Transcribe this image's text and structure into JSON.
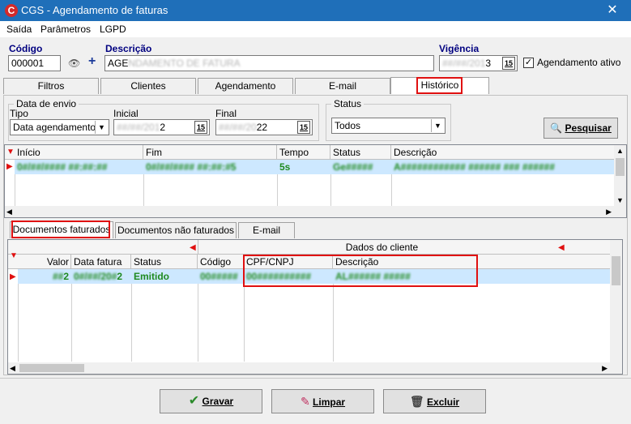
{
  "window": {
    "title": "CGS - Agendamento de faturas",
    "close_glyph": "✕"
  },
  "menu": [
    "Saída",
    "Parâmetros",
    "LGPD"
  ],
  "form": {
    "codigo_label": "Código",
    "codigo_value": "000001",
    "descricao_label": "Descrição",
    "descricao_value": "AGE",
    "descricao_blurred": "NDAMENTO DE FATURA",
    "vigencia_label": "Vigência",
    "vigencia_blurred": "##/##/201",
    "vigencia_end": "3",
    "agendamento_ativo_label": "Agendamento ativo",
    "agendamento_ativo_checked": true
  },
  "tabs": [
    "Filtros",
    "Clientes",
    "Agendamento",
    "E-mail",
    "Histórico"
  ],
  "active_tab": "Histórico",
  "filtros": {
    "data_envio_legend": "Data de envio",
    "tipo_label": "Tipo",
    "tipo_value": "Data agendamento",
    "inicial_label": "Inicial",
    "inicial_blurred": "##/##/201",
    "inicial_end": "2",
    "final_label": "Final",
    "final_blurred": "##/##/20",
    "final_end": "22",
    "status_legend": "Status",
    "status_value": "Todos",
    "pesquisar_label": "Pesquisar",
    "cal_label": "15"
  },
  "historico_grid": {
    "columns": [
      "Início",
      "Fim",
      "Tempo",
      "Status",
      "Descrição"
    ],
    "rows": [
      {
        "inicio": "0#/##/#### ##:##:##",
        "fim": "0#/##/#### ##:##:#5",
        "tempo": "5s",
        "status": "Ge#####",
        "descricao": "A############ ###### ### ######"
      }
    ]
  },
  "sub_tabs": [
    "Documentos faturados",
    "Documentos não faturados",
    "E-mail"
  ],
  "active_sub_tab": "Documentos faturados",
  "docs_grid": {
    "group_header": "Dados do cliente",
    "columns": [
      "Valor",
      "Data fatura",
      "Status",
      "Código",
      "CPF/CNPJ",
      "Descrição"
    ],
    "rows": [
      {
        "valor": "2",
        "valor_blur": "##",
        "data_fatura_blur": "0#/##/20#",
        "data_fatura_end": "2",
        "status": "Emitido",
        "codigo": "00#####",
        "cpf_cnpj": "00##########",
        "descricao": "AL###### #####"
      }
    ]
  },
  "buttons": {
    "gravar": "Gravar",
    "limpar": "Limpar",
    "excluir": "Excluir"
  }
}
